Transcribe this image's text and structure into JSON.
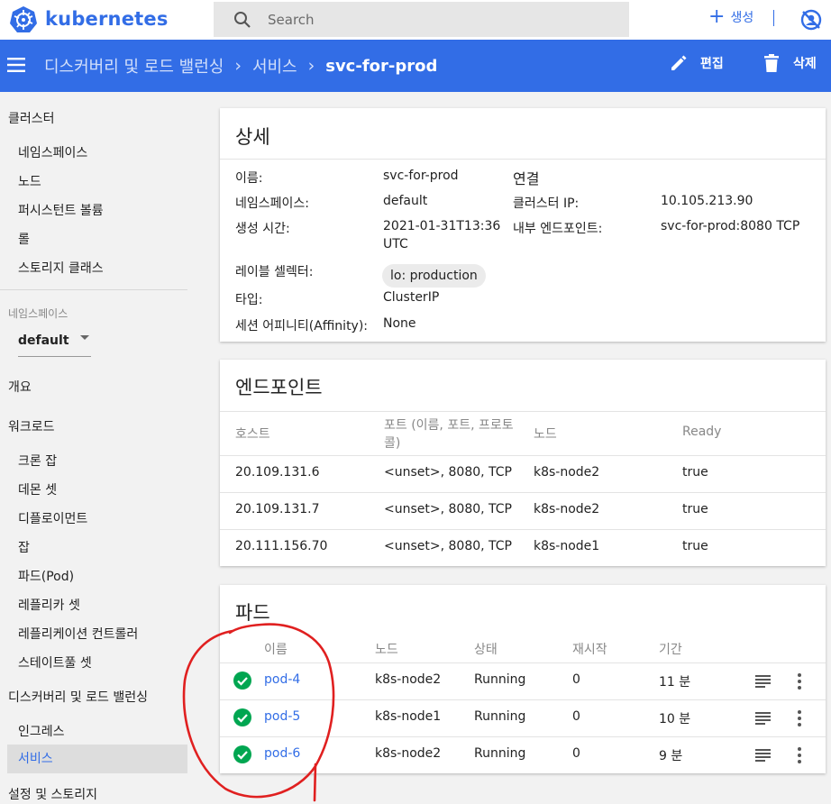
{
  "app": {
    "brand": "kubernetes"
  },
  "search": {
    "placeholder": "Search"
  },
  "topbar": {
    "create_label": "생성"
  },
  "breadcrumb": {
    "items": [
      "디스커버리 및 로드 밸런싱",
      "서비스"
    ],
    "current": "svc-for-prod"
  },
  "actions": {
    "edit_label": "편집",
    "delete_label": "삭제"
  },
  "sidebar": {
    "cluster_header": "클러스터",
    "cluster_items": [
      "네임스페이스",
      "노드",
      "퍼시스턴트 볼륨",
      "롤",
      "스토리지 클래스"
    ],
    "namespace_label": "네임스페이스",
    "namespace_value": "default",
    "overview": "개요",
    "workloads_header": "워크로드",
    "workload_items": [
      "크론 잡",
      "데몬 셋",
      "디플로이먼트",
      "잡",
      "파드(Pod)",
      "레플리카 셋",
      "레플리케이션 컨트롤러",
      "스테이트풀 셋"
    ],
    "discovery_header": "디스커버리 및 로드 밸런싱",
    "discovery_items": [
      "인그레스",
      "서비스"
    ],
    "config_header": "설정 및 스토리지"
  },
  "details": {
    "title": "상세",
    "name_label": "이름:",
    "name_value": "svc-for-prod",
    "namespace_label": "네임스페이스:",
    "namespace_value": "default",
    "created_label": "생성 시간:",
    "created_value_1": "2021-01-31T13:36",
    "created_value_2": "UTC",
    "selector_label": "레이블 셀렉터:",
    "selector_value": "lo: production",
    "type_label": "타입:",
    "type_value": "ClusterIP",
    "affinity_label": "세션 어피니티(Affinity):",
    "affinity_value": "None",
    "conn_title": "연결",
    "cluster_ip_label": "클러스터 IP:",
    "cluster_ip_value": "10.105.213.90",
    "internal_ep_label": "내부 엔드포인트:",
    "internal_ep_value": "svc-for-prod:8080 TCP"
  },
  "endpoints": {
    "title": "엔드포인트",
    "headers": {
      "host": "호스트",
      "ports_1": "포트 (이름, 포트, 프로토",
      "ports_2": "콜)",
      "node": "노드",
      "ready": "Ready"
    },
    "rows": [
      {
        "host": "20.109.131.6",
        "ports": "<unset>, 8080, TCP",
        "node": "k8s-node2",
        "ready": "true"
      },
      {
        "host": "20.109.131.7",
        "ports": "<unset>, 8080, TCP",
        "node": "k8s-node2",
        "ready": "true"
      },
      {
        "host": "20.111.156.70",
        "ports": "<unset>, 8080, TCP",
        "node": "k8s-node1",
        "ready": "true"
      }
    ]
  },
  "pods": {
    "title": "파드",
    "headers": {
      "name": "이름",
      "node": "노드",
      "status": "상태",
      "restarts": "재시작",
      "age": "기간"
    },
    "rows": [
      {
        "name": "pod-4",
        "node": "k8s-node2",
        "status": "Running",
        "restarts": "0",
        "age": "11 분"
      },
      {
        "name": "pod-5",
        "node": "k8s-node1",
        "status": "Running",
        "restarts": "0",
        "age": "10 분"
      },
      {
        "name": "pod-6",
        "node": "k8s-node2",
        "status": "Running",
        "restarts": "0",
        "age": "9 분"
      }
    ]
  },
  "colors": {
    "accent": "#326de6",
    "success": "#00a651",
    "annotation": "#e02020"
  }
}
